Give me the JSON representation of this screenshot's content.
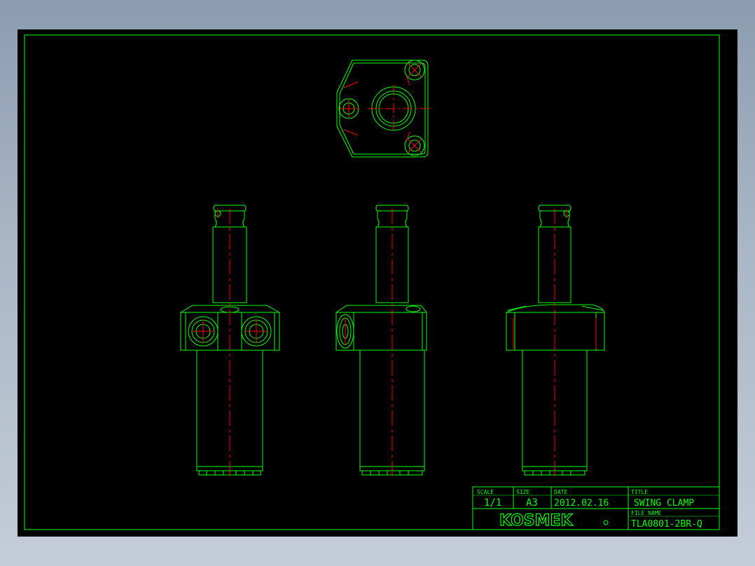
{
  "colors": {
    "background": "#000000",
    "geometry": "#00ff00",
    "centerline": "#ff0000",
    "window_backdrop": "#a3b0c0"
  },
  "title_block": {
    "scale_label": "SCALE",
    "scale_value": "1/1",
    "size_label": "SIZE",
    "size_value": "A3",
    "date_label": "DATE",
    "date_value": "2012.02.16",
    "title_label": "TITLE",
    "title_value": "SWING CLAMP",
    "file_name_label": "FILE NAME",
    "file_name_value": "TLA0801-2BR-Q",
    "logo_text": "KOSMEK"
  },
  "views": [
    "top-view",
    "front-view-left",
    "front-view-center",
    "front-view-right"
  ]
}
